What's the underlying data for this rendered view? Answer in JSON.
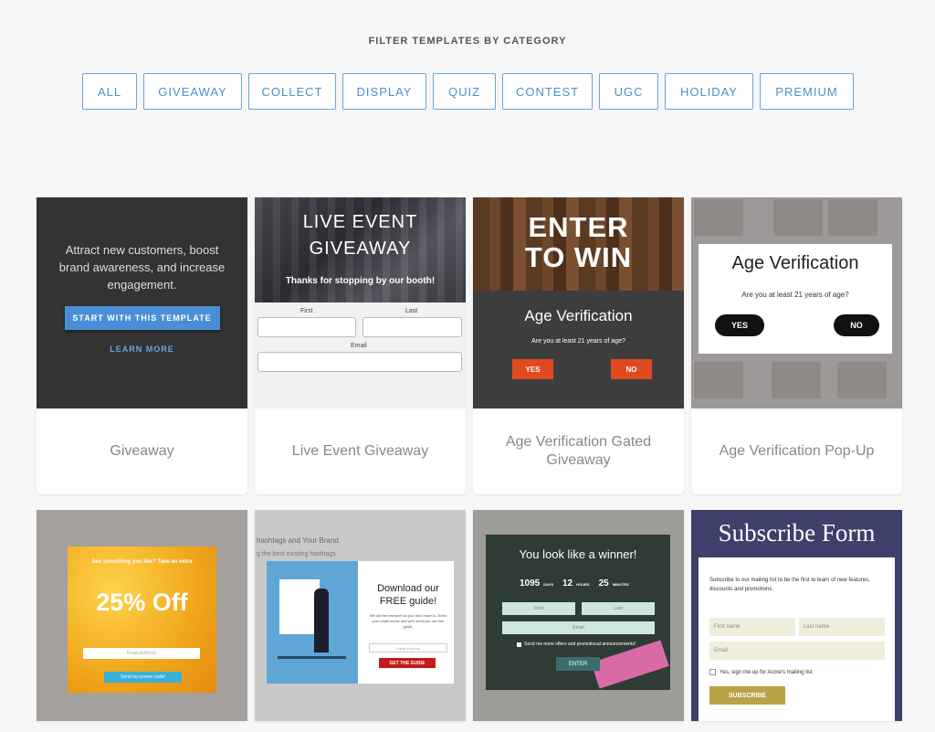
{
  "filter": {
    "heading": "FILTER TEMPLATES BY CATEGORY",
    "buttons": [
      "ALL",
      "GIVEAWAY",
      "COLLECT",
      "DISPLAY",
      "QUIZ",
      "CONTEST",
      "UGC",
      "HOLIDAY",
      "PREMIUM"
    ]
  },
  "cards": {
    "c1": {
      "title": "Giveaway",
      "hover_text": "Attract new customers, boost brand awareness, and increase engagement.",
      "start_label": "START WITH THIS TEMPLATE",
      "learn_label": "LEARN MORE"
    },
    "c2": {
      "title": "Live Event Giveaway",
      "heading1": "LIVE EVENT",
      "heading2": "GIVEAWAY",
      "subheading": "Thanks for stopping by our booth!",
      "first_label": "First",
      "last_label": "Last",
      "email_label": "Email"
    },
    "c3": {
      "title": "Age Verification Gated Giveaway",
      "enter1": "ENTER",
      "enter2": "TO WIN",
      "heading": "Age Verification",
      "question": "Are you at least 21 years of age?",
      "yes": "YES",
      "no": "NO"
    },
    "c4": {
      "title": "Age Verification Pop-Up",
      "heading": "Age Verification",
      "question": "Are you at least 21 years of age?",
      "yes": "YES",
      "no": "NO"
    },
    "c5": {
      "top_text": "See something you like? Take an extra",
      "offer": "25% Off",
      "email_placeholder": "Email Address",
      "button": "Send my promo code!"
    },
    "c6": {
      "bg_line1": "hashtags and Your Brand",
      "bg_line2": "g the best existing hashtags",
      "heading1": "Download our",
      "heading2": "FREE guide!",
      "body": "We did the research so you don't have to. Enter your email below and we'll send you our free guide.",
      "email_placeholder": "Email Address",
      "button": "GET THE GUIDE"
    },
    "c7": {
      "heading": "You look like a winner!",
      "days_num": "1095",
      "days_lbl": "DAYS",
      "hours_num": "12",
      "hours_lbl": "HOURS",
      "mins_num": "25",
      "mins_lbl": "MINUTES",
      "first_ph": "First",
      "last_ph": "Last",
      "email_ph": "Email",
      "checkbox": "Send me more offers and promotional announcements!",
      "button": "ENTER"
    },
    "c8": {
      "heading": "Subscribe Form",
      "body": "Subscribe to our mailing list to be the first to learn of new features, discounts and promotions.",
      "first_ph": "First name",
      "last_ph": "Last name",
      "email_ph": "Email",
      "checkbox": "Yes, sign me up for Acme's mailing list",
      "button": "SUBSCRIBE"
    }
  },
  "colors": {
    "accent": "#4c8fd0",
    "orange": "#e04a1f",
    "navy": "#3f3f6b",
    "gold": "#b9a347"
  }
}
